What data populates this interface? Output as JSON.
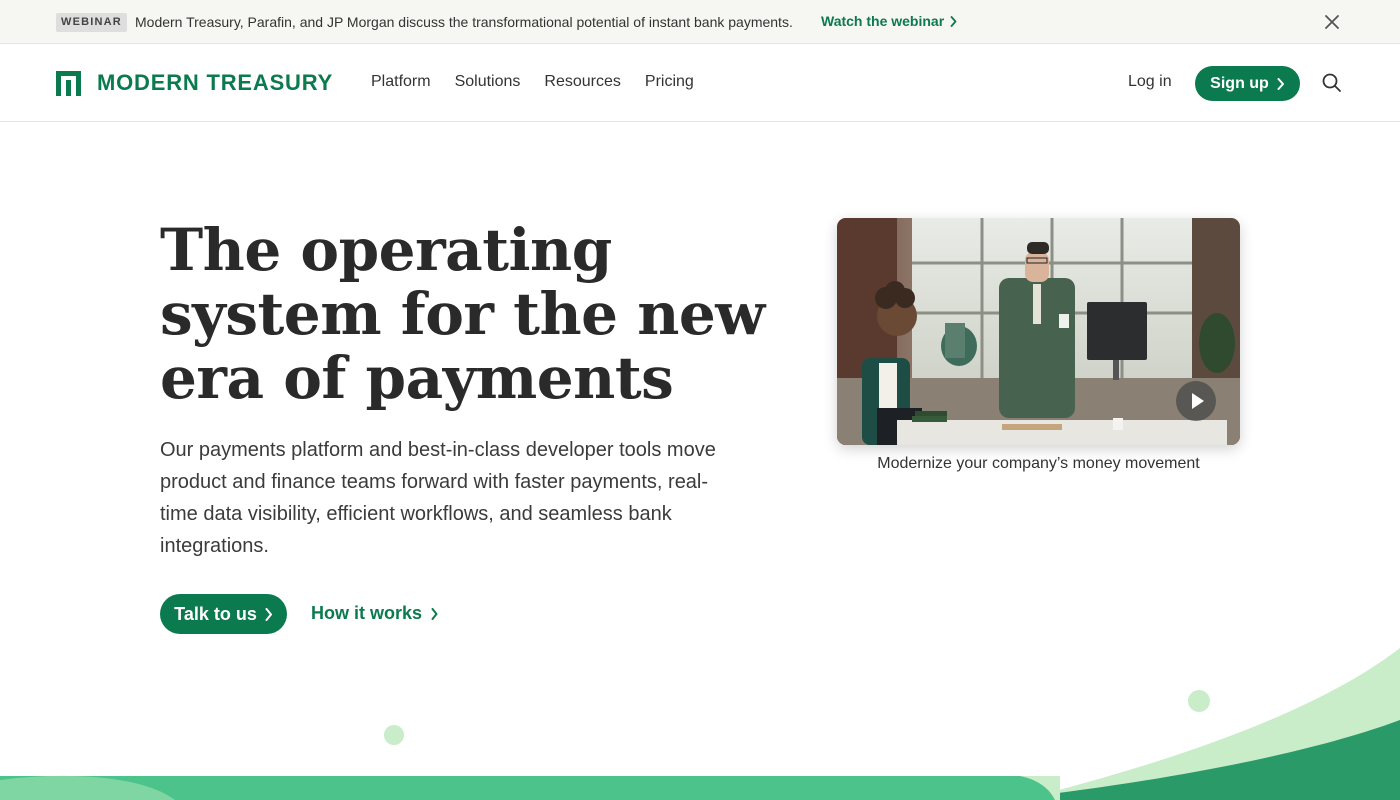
{
  "banner": {
    "tag": "WEBINAR",
    "text": "Modern Treasury, Parafin, and JP Morgan discuss the transformational potential of instant bank payments.",
    "link": "Watch the webinar",
    "close_icon": "close-icon"
  },
  "nav": {
    "brand": "MODERN TREASURY",
    "links": [
      "Platform",
      "Solutions",
      "Resources",
      "Pricing"
    ],
    "login": "Log in",
    "signup": "Sign up",
    "search_icon": "search-icon"
  },
  "hero": {
    "title": "The operating system for the new era of payments",
    "subtitle": "Our payments platform and best-in-class developer tools move product and finance teams forward with faster payments, real-time data visibility, efficient workflows, and seamless bank integrations.",
    "primary_cta": "Talk to us",
    "secondary_cta": "How it works"
  },
  "video": {
    "caption": "Modernize your company’s money movement",
    "play_icon": "play-icon"
  },
  "colors": {
    "brand_green": "#0b7a4e",
    "light_green": "#c9ecc9",
    "mid_green": "#4cc38a",
    "banner_bg": "#f6f6f3"
  }
}
